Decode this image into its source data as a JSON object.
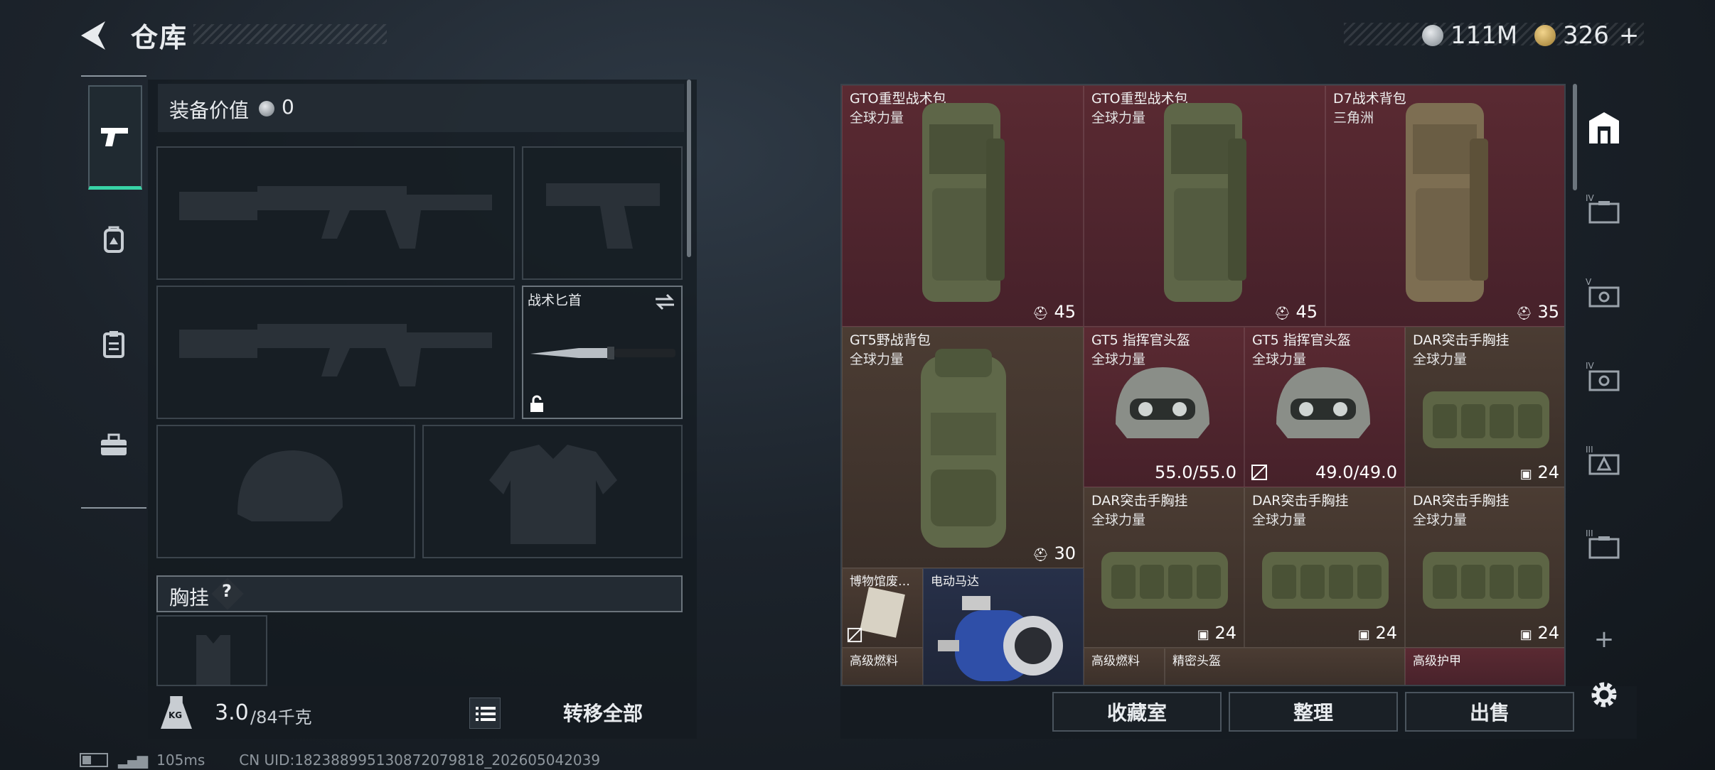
{
  "header": {
    "title": "仓库",
    "currency_a": "111M",
    "currency_b": "326",
    "add_symbol": "+"
  },
  "left_nav": [
    {
      "icon": "pistol-icon",
      "active": true
    },
    {
      "icon": "backpack-icon",
      "active": false
    },
    {
      "icon": "clipboard-icon",
      "active": false
    },
    {
      "icon": "toolbox-icon",
      "active": false
    }
  ],
  "equipment": {
    "value_label": "装备价值",
    "value": "0",
    "knife_name": "战术匕首",
    "chest_label": "胸挂",
    "help": "?"
  },
  "weight": {
    "icon_text": "KG",
    "current": "3.0",
    "max": "/84千克",
    "transfer_all": "转移全部"
  },
  "storage_items": [
    {
      "name": "GTO重型战术包",
      "sub": "全球力量",
      "count": "45"
    },
    {
      "name": "GTO重型战术包",
      "sub": "全球力量",
      "count": "45"
    },
    {
      "name": "D7战术背包",
      "sub": "三角洲",
      "count": "35"
    },
    {
      "name": "GT5野战背包",
      "sub": "全球力量",
      "count": "30"
    },
    {
      "name": "GT5 指挥官头盔",
      "sub": "全球力量",
      "count": "55.0/55.0"
    },
    {
      "name": "GT5 指挥官头盔",
      "sub": "全球力量",
      "count": "49.0/49.0"
    },
    {
      "name": "DAR突击手胸挂",
      "sub": "全球力量",
      "count": "24"
    },
    {
      "name": "DAR突击手胸挂",
      "sub": "全球力量",
      "count": "24"
    },
    {
      "name": "DAR突击手胸挂",
      "sub": "全球力量",
      "count": "24"
    },
    {
      "name": "DAR突击手胸挂",
      "sub": "全球力量",
      "count": "24"
    },
    {
      "name": "博物馆废…",
      "sub": "",
      "count": ""
    },
    {
      "name": "电动马达",
      "sub": "",
      "count": ""
    },
    {
      "name": "高级燃料",
      "sub": "",
      "count": ""
    },
    {
      "name": "高级燃料",
      "sub": "",
      "count": ""
    },
    {
      "name": "精密头盔",
      "sub": "",
      "count": ""
    },
    {
      "name": "高级护甲",
      "sub": "",
      "count": ""
    }
  ],
  "storage_buttons": {
    "collection": "收藏室",
    "organize": "整理",
    "sell": "出售"
  },
  "right_nav": {
    "tiers": [
      "IV",
      "V",
      "IV",
      "III",
      "III"
    ],
    "add": "+"
  },
  "status": {
    "ping": "105ms",
    "uid": "CN UID:18238899513087207981​8_202605042039"
  }
}
